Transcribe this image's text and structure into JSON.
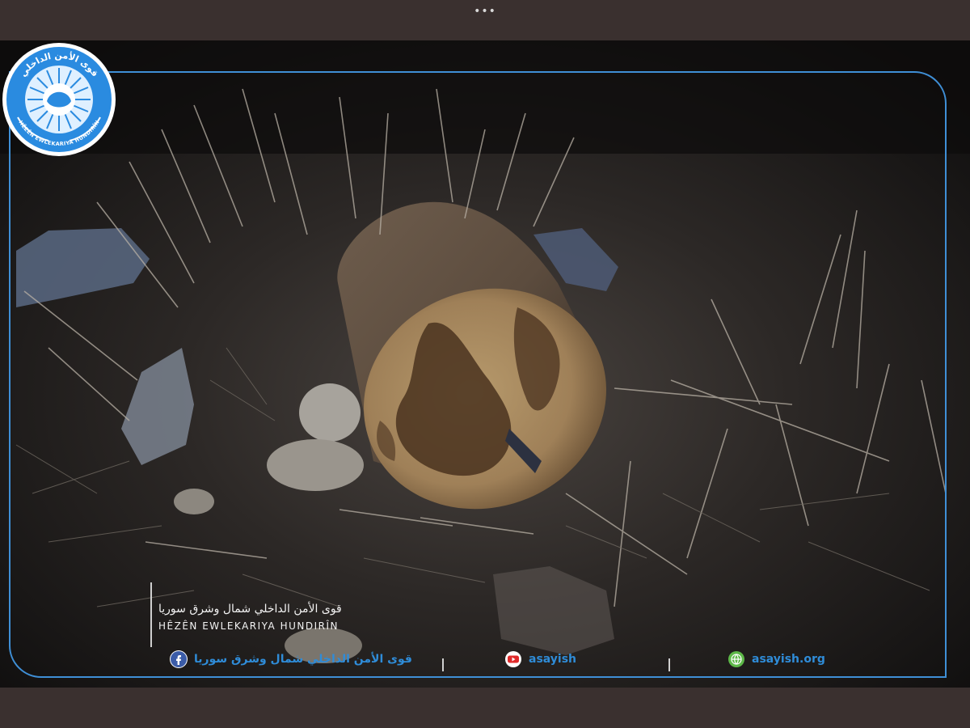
{
  "viewer": {
    "more_icon": "more-horizontal-icon",
    "more_glyph": "•••"
  },
  "watermark": {
    "accent_color": "#3f8fd6",
    "logo_icon": "asayish-emblem-icon",
    "logo_top_text": "قوى الأمن الداخلي",
    "logo_bottom_text": "HÊZÊN EWLEKARIYA HUNDIRÎN",
    "arabic_name": "قوى الأمن الداخلي شمال وشرق سوريا",
    "kurdish_name": "HÊZÊN EWLEKARIYA HUNDIRÎN",
    "social": [
      {
        "icon": "facebook-icon",
        "text": "قوى الأمن الداخلي شمال وشرق سوريا"
      },
      {
        "icon": "youtube-icon",
        "text": "asayish"
      },
      {
        "icon": "globe-icon",
        "text": "asayish.org"
      }
    ]
  }
}
